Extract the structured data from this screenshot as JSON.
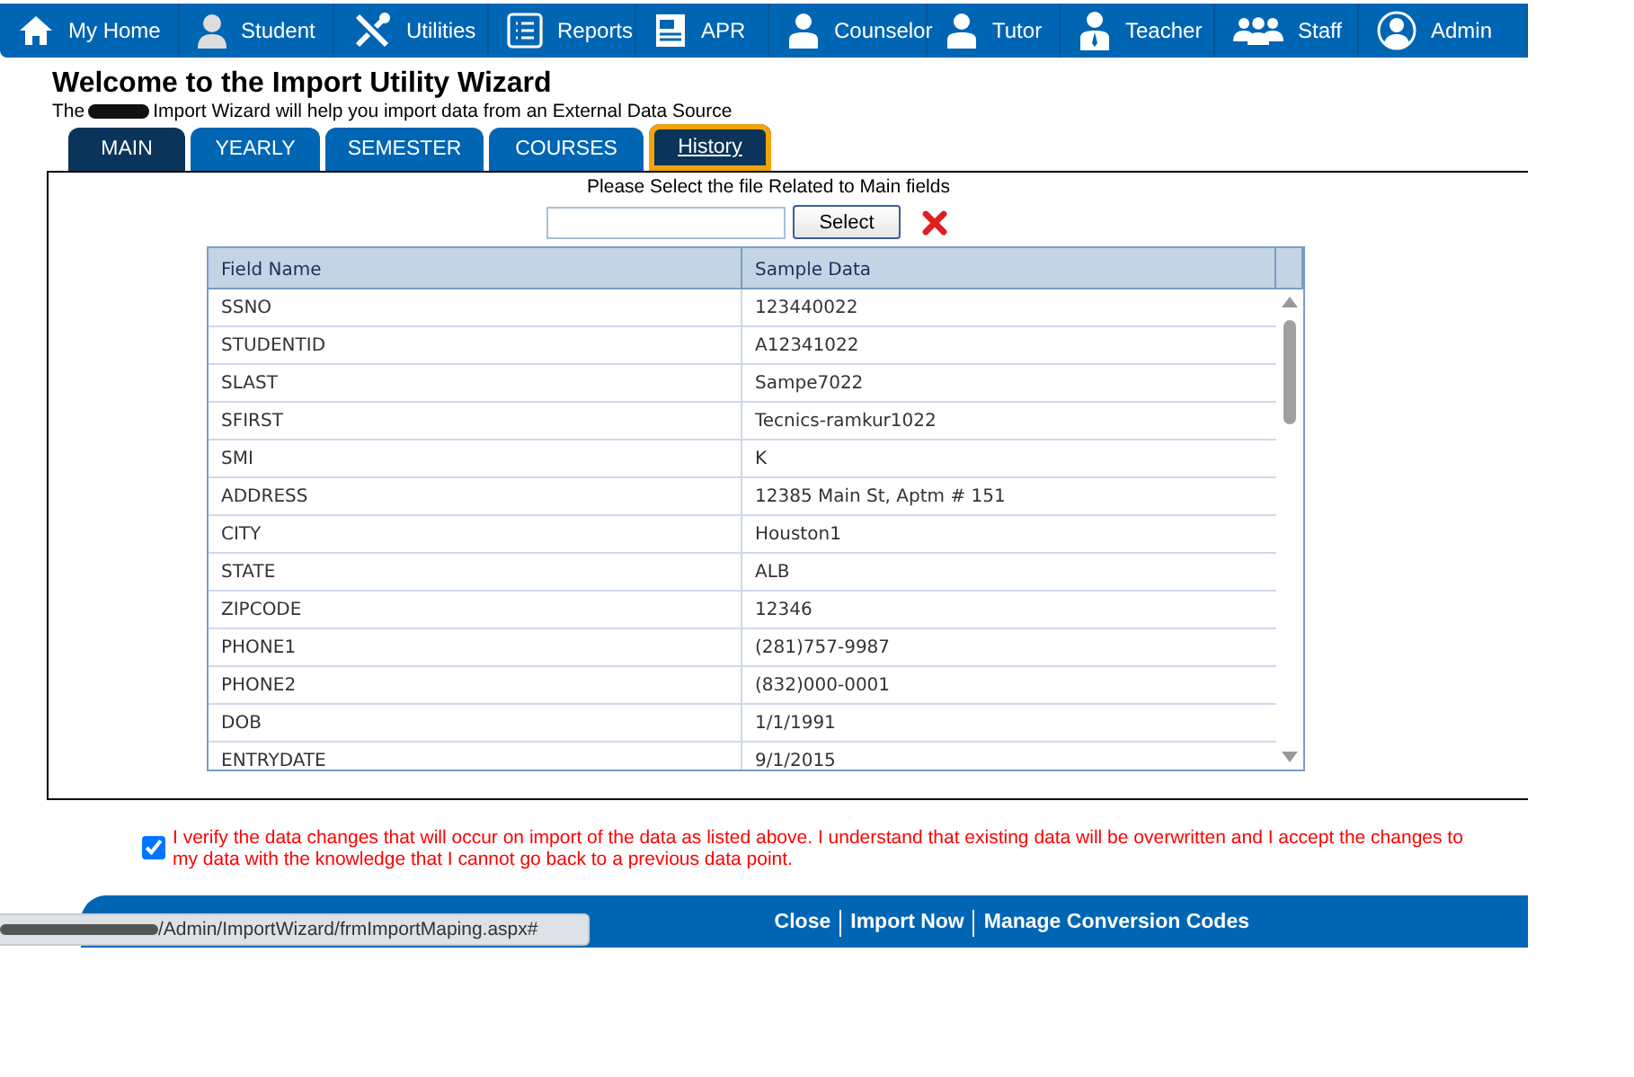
{
  "nav": {
    "items": [
      {
        "label": "My Home"
      },
      {
        "label": "Student"
      },
      {
        "label": "Utilities"
      },
      {
        "label": "Reports"
      },
      {
        "label": "APR"
      },
      {
        "label": "Counselor"
      },
      {
        "label": "Tutor"
      },
      {
        "label": "Teacher"
      },
      {
        "label": "Staff"
      },
      {
        "label": "Admin"
      }
    ]
  },
  "page": {
    "title": "Welcome to the Import Utility Wizard",
    "subtitle_start": "The",
    "subtitle_end": "Import Wizard will help you import data from an External Data Source"
  },
  "tabs": [
    {
      "label": "MAIN",
      "selected": true,
      "focused": false
    },
    {
      "label": "YEARLY",
      "selected": false,
      "focused": false
    },
    {
      "label": "SEMESTER",
      "selected": false,
      "focused": false
    },
    {
      "label": "COURSES",
      "selected": false,
      "focused": false
    },
    {
      "label": "History",
      "selected": true,
      "focused": true
    }
  ],
  "file_picker": {
    "prompt": "Please Select the file Related to Main fields",
    "button": "Select"
  },
  "table": {
    "columns": [
      "Field Name",
      "Sample Data"
    ],
    "rows": [
      [
        "SSNO",
        "123440022"
      ],
      [
        "STUDENTID",
        "A12341022"
      ],
      [
        "SLAST",
        "Sampe7022"
      ],
      [
        "SFIRST",
        "Tecnics-ramkur1022"
      ],
      [
        "SMI",
        "K"
      ],
      [
        "ADDRESS",
        "12385 Main St, Aptm # 151"
      ],
      [
        "CITY",
        "Houston1"
      ],
      [
        "STATE",
        "ALB"
      ],
      [
        "ZIPCODE",
        "12346"
      ],
      [
        "PHONE1",
        "(281)757-9987"
      ],
      [
        "PHONE2",
        "(832)000-0001"
      ],
      [
        "DOB",
        "1/1/1991"
      ],
      [
        "ENTRYDATE",
        "9/1/2015"
      ]
    ]
  },
  "verify": {
    "checked": true,
    "text": "I verify the data changes that will occur on import of the data as listed above. I understand that existing data will be overwritten and I accept the changes to my data with the knowledge that I cannot go back to a previous data point."
  },
  "footer": {
    "links": [
      "Close",
      "Import Now",
      "Manage Conversion Codes"
    ]
  },
  "status_bar": {
    "url": "/Admin/ImportWizard/frmImportMaping.aspx#"
  }
}
